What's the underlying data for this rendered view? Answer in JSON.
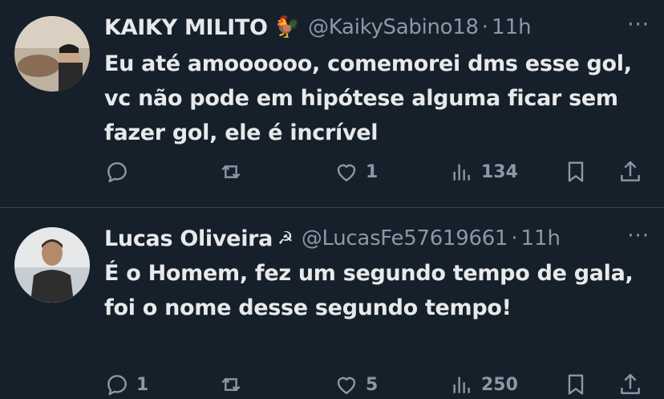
{
  "tweets": [
    {
      "name": "KAIKY MILITO",
      "emoji": "🐓",
      "handle": "@KaikySabino18",
      "separator": "·",
      "time": "11h",
      "more": "···",
      "text": "Eu até amoooooo, comemorei dms esse gol,\nvc não pode em hipótese alguma ficar sem\nfazer gol, ele é incrível",
      "reply_count": "",
      "retweet_count": "",
      "like_count": "1",
      "view_count": "134"
    },
    {
      "name": "Lucas Oliveira",
      "emoji": "☭",
      "handle": "@LucasFe57619661",
      "separator": "·",
      "time": "11h",
      "more": "···",
      "text": "É o Homem, fez um segundo tempo de gala,\nfoi o nome desse segundo tempo!",
      "reply_count": "1",
      "retweet_count": "",
      "like_count": "5",
      "view_count": "250"
    }
  ],
  "colors": {
    "background": "#15202b",
    "text": "#e7e9ea",
    "secondary": "#8b98a5",
    "divider": "#38444d"
  }
}
